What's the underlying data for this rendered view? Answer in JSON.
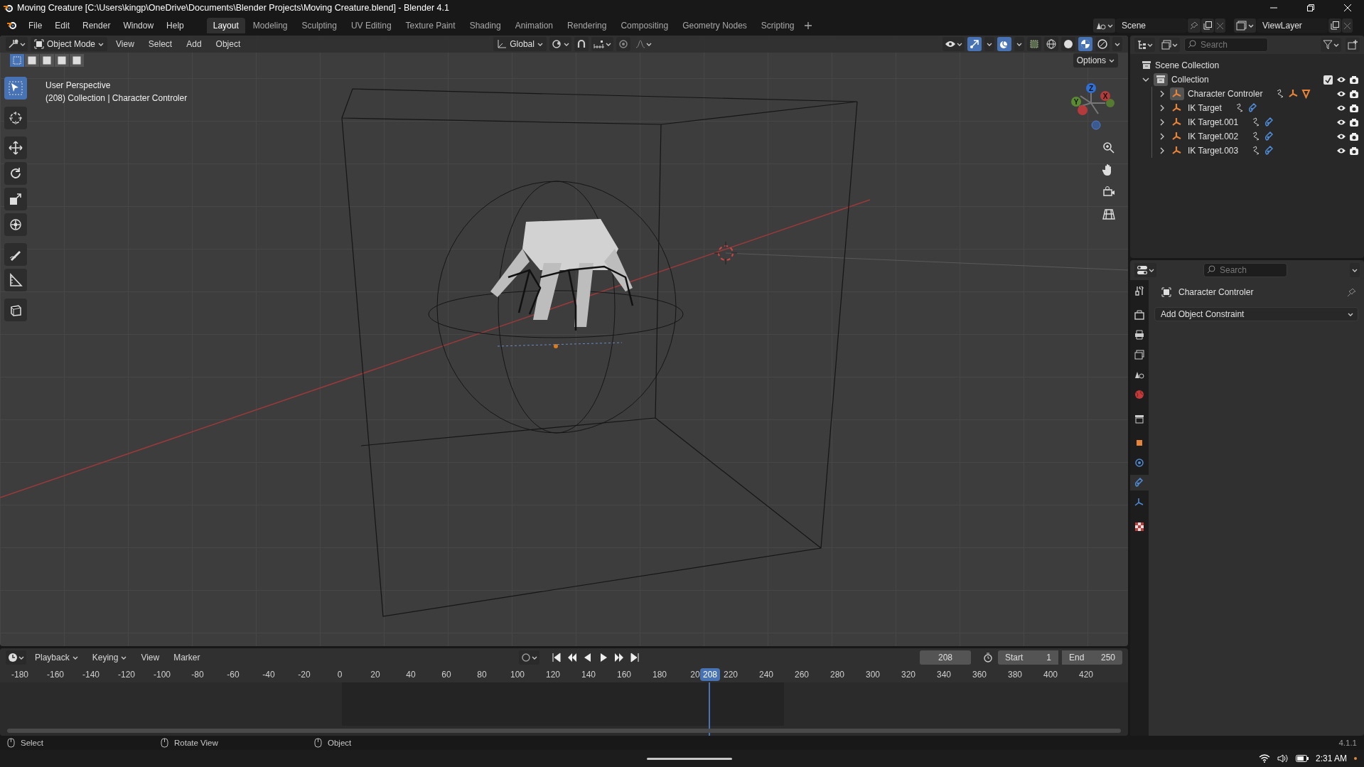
{
  "window": {
    "title": "Moving Creature [C:\\Users\\kingp\\OneDrive\\Documents\\Blender Projects\\Moving Creature.blend] - Blender 4.1"
  },
  "menu": [
    "File",
    "Edit",
    "Render",
    "Window",
    "Help"
  ],
  "workspaces": [
    {
      "label": "Layout",
      "selected": true
    },
    {
      "label": "Modeling",
      "selected": false
    },
    {
      "label": "Sculpting",
      "selected": false
    },
    {
      "label": "UV Editing",
      "selected": false
    },
    {
      "label": "Texture Paint",
      "selected": false
    },
    {
      "label": "Shading",
      "selected": false
    },
    {
      "label": "Animation",
      "selected": false
    },
    {
      "label": "Rendering",
      "selected": false
    },
    {
      "label": "Compositing",
      "selected": false
    },
    {
      "label": "Geometry Nodes",
      "selected": false
    },
    {
      "label": "Scripting",
      "selected": false
    }
  ],
  "scene": {
    "name": "Scene"
  },
  "view_layer": {
    "name": "ViewLayer"
  },
  "viewport": {
    "mode": "Object Mode",
    "menus": [
      "View",
      "Select",
      "Add",
      "Object"
    ],
    "orientation": "Global",
    "options": "Options",
    "select_modes": [
      {
        "selected": true
      },
      {
        "selected": false
      },
      {
        "selected": false
      },
      {
        "selected": false
      },
      {
        "selected": false
      }
    ],
    "tools": [
      {
        "kind": "select",
        "selected": true
      },
      {
        "kind": "cursor",
        "selected": false
      },
      {
        "kind": "move",
        "selected": false
      },
      {
        "kind": "rotate",
        "selected": false
      },
      {
        "kind": "scale",
        "selected": false
      },
      {
        "kind": "transform",
        "selected": false
      },
      {
        "kind": "annotate",
        "selected": false
      },
      {
        "kind": "measure",
        "selected": false
      },
      {
        "kind": "add_cube",
        "selected": false
      }
    ],
    "shading": [
      {
        "kind": "wireframe",
        "selected": false
      },
      {
        "kind": "solid",
        "selected": false
      },
      {
        "kind": "material",
        "selected": true
      },
      {
        "kind": "rendered",
        "selected": false
      }
    ],
    "info": [
      "User Perspective",
      "(208) Collection | Character Controler"
    ],
    "gizmo_axes": [
      "Z",
      "Y",
      "X"
    ]
  },
  "outliner": {
    "search": {
      "placeholder": "Search"
    },
    "root": "Scene Collection",
    "collection": {
      "label": "Collection",
      "expanded": true,
      "checked": true,
      "children": [
        {
          "label": "Character Controler",
          "active": true,
          "expanded": false,
          "extras": [
            {
              "kind": "modifier"
            },
            {
              "kind": "armature"
            },
            {
              "kind": "mesh"
            }
          ]
        },
        {
          "label": "IK Target",
          "active": false,
          "expanded": false,
          "extras": [
            {
              "kind": "modifier"
            },
            {
              "kind": "constraint"
            }
          ]
        },
        {
          "label": "IK Target.001",
          "active": false,
          "expanded": false,
          "extras": [
            {
              "kind": "modifier"
            },
            {
              "kind": "constraint"
            }
          ]
        },
        {
          "label": "IK Target.002",
          "active": false,
          "expanded": false,
          "extras": [
            {
              "kind": "modifier"
            },
            {
              "kind": "constraint"
            }
          ]
        },
        {
          "label": "IK Target.003",
          "active": false,
          "expanded": false,
          "extras": [
            {
              "kind": "modifier"
            },
            {
              "kind": "constraint"
            }
          ]
        }
      ]
    }
  },
  "properties": {
    "search": {
      "placeholder": "Search"
    },
    "object_name": "Character Controler",
    "add_constraint": "Add Object Constraint",
    "tabs": [
      {
        "kind": "tool",
        "selected": false
      },
      {
        "kind": "render",
        "selected": false
      },
      {
        "kind": "output",
        "selected": false
      },
      {
        "kind": "view_layer",
        "selected": false
      },
      {
        "kind": "scene",
        "selected": false
      },
      {
        "kind": "world",
        "selected": false
      },
      {
        "kind": "collection",
        "selected": false
      },
      {
        "kind": "object",
        "selected": false
      },
      {
        "kind": "physics",
        "selected": false
      },
      {
        "kind": "constraints",
        "selected": true
      },
      {
        "kind": "data",
        "selected": false
      },
      {
        "kind": "texture",
        "selected": false
      }
    ]
  },
  "timeline": {
    "menus": [
      "Playback",
      "Keying",
      "View",
      "Marker"
    ],
    "current_frame": "208",
    "start_label": "Start",
    "start": "1",
    "end_label": "End",
    "end": "250",
    "ticks": [
      "-180",
      "-160",
      "-140",
      "-120",
      "-100",
      "-80",
      "-60",
      "-40",
      "-20",
      "0",
      "20",
      "40",
      "60",
      "80",
      "100",
      "120",
      "140",
      "160",
      "180",
      "20",
      "220",
      "240",
      "260",
      "280",
      "300",
      "320",
      "340",
      "360",
      "380",
      "400",
      "420"
    ],
    "playhead": "208"
  },
  "status_bar": {
    "hints": [
      "Select",
      "Rotate View",
      "Object"
    ],
    "version": "4.1.1"
  },
  "taskbar": {
    "time": "2:31 AM"
  }
}
